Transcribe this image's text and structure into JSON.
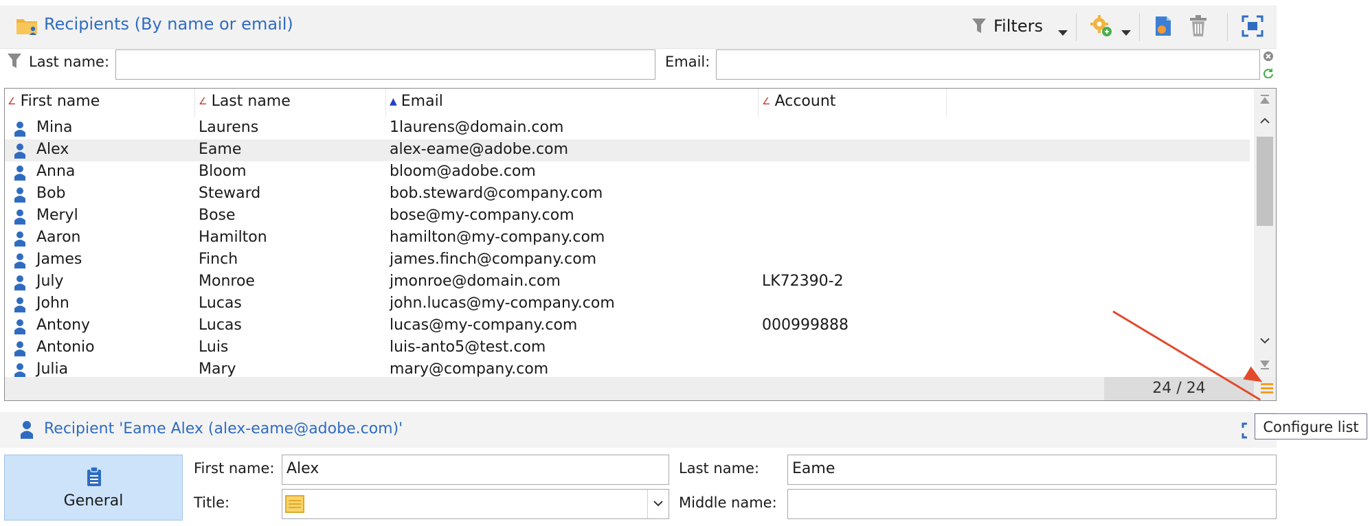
{
  "toolbar": {
    "title": "Recipients (By name or email)",
    "filters_label": "Filters"
  },
  "filter_row": {
    "last_name_label": "Last name:",
    "last_name_value": "",
    "email_label": "Email:",
    "email_value": ""
  },
  "grid": {
    "columns": [
      "First name",
      "Last name",
      "Email",
      "Account"
    ],
    "rows": [
      {
        "first": "Mina",
        "last": "Laurens",
        "email": "1laurens@domain.com",
        "account": ""
      },
      {
        "first": "Alex",
        "last": "Eame",
        "email": "alex-eame@adobe.com",
        "account": ""
      },
      {
        "first": "Anna",
        "last": "Bloom",
        "email": "bloom@adobe.com",
        "account": ""
      },
      {
        "first": "Bob",
        "last": "Steward",
        "email": "bob.steward@company.com",
        "account": ""
      },
      {
        "first": "Meryl",
        "last": "Bose",
        "email": "bose@my-company.com",
        "account": ""
      },
      {
        "first": "Aaron",
        "last": "Hamilton",
        "email": "hamilton@my-company.com",
        "account": ""
      },
      {
        "first": "James",
        "last": "Finch",
        "email": "james.finch@company.com",
        "account": ""
      },
      {
        "first": "July",
        "last": "Monroe",
        "email": "jmonroe@domain.com",
        "account": "LK72390-2"
      },
      {
        "first": "John",
        "last": "Lucas",
        "email": "john.lucas@my-company.com",
        "account": ""
      },
      {
        "first": "Antony",
        "last": "Lucas",
        "email": "lucas@my-company.com",
        "account": "000999888"
      },
      {
        "first": "Antonio",
        "last": "Luis",
        "email": "luis-anto5@test.com",
        "account": ""
      },
      {
        "first": "Julia",
        "last": "Mary",
        "email": "mary@company.com",
        "account": ""
      }
    ],
    "selected_row": 1,
    "count": "24 / 24"
  },
  "tooltip": "Configure list",
  "detail": {
    "title": "Recipient 'Eame Alex (alex-eame@adobe.com)'",
    "tab_label": "General",
    "first_name_label": "First name:",
    "first_name_value": "Alex",
    "last_name_label": "Last name:",
    "last_name_value": "Eame",
    "title_label": "Title:",
    "middle_name_label": "Middle name:",
    "middle_name_value": ""
  },
  "colors": {
    "accent": "#2f6cc1",
    "arrow": "#e34a2c",
    "selected_row": "#eeeeee",
    "tab_active": "#cde3fa"
  }
}
